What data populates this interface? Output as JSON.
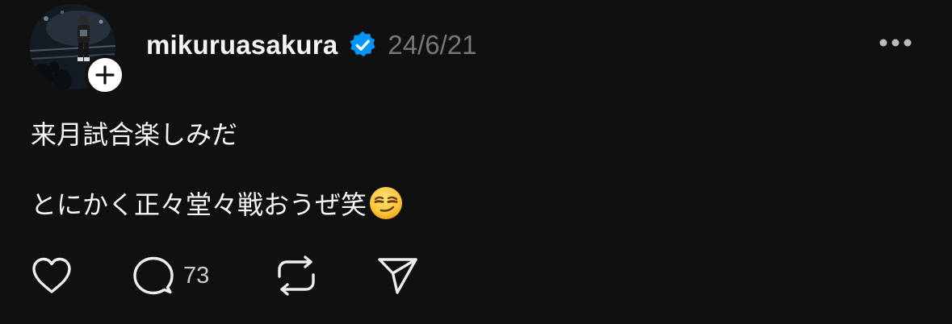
{
  "post": {
    "username": "mikuruasakura",
    "date": "24/6/21",
    "verified": true,
    "lines": [
      "来月試合楽しみだ",
      "とにかく正々堂々戦おうぜ笑"
    ],
    "trailing_emoji_icon": "smirking-face-icon"
  },
  "actions": {
    "like_icon": "heart-icon",
    "reply_icon": "speech-bubble-icon",
    "reply_count": "73",
    "repost_icon": "repost-icon",
    "share_icon": "paper-plane-icon"
  },
  "colors": {
    "background": "#101010",
    "text": "#f3f5f7",
    "muted": "#777777",
    "verified": "#0095f6"
  }
}
